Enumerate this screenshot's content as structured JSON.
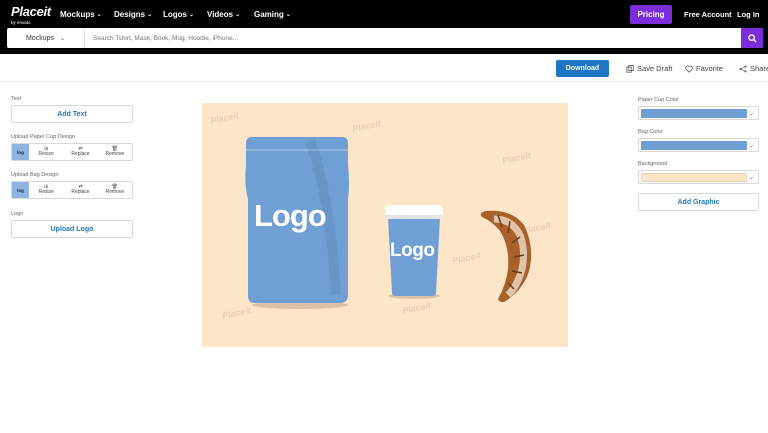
{
  "brand": {
    "name": "Placeit",
    "tagline": "by envato"
  },
  "nav": {
    "items": [
      {
        "label": "Mockups"
      },
      {
        "label": "Designs"
      },
      {
        "label": "Logos"
      },
      {
        "label": "Videos"
      },
      {
        "label": "Gaming"
      }
    ],
    "pricing": "Pricing",
    "free_account": "Free Account",
    "login": "Log In"
  },
  "search": {
    "category": "Mockups",
    "placeholder": "Search Tshirt, Mask, Book, Mug, Hoodie, iPhone..."
  },
  "toolbar": {
    "download": "Download",
    "save_draft": "Save Draft",
    "favorite": "Favorite",
    "share": "Share"
  },
  "left_panel": {
    "text_label": "Text",
    "add_text": "Add Text",
    "cup_design_label": "Upload Paper Cup Design",
    "bag_design_label": "Upload Bag Design",
    "thumb_text": "log",
    "actions": [
      "Resize",
      "Replace",
      "Remove"
    ],
    "logo_label": "Logo",
    "upload_logo": "Upload Logo"
  },
  "canvas": {
    "bag_logo": "Logo",
    "cup_logo": "Logo",
    "watermark": "Placeit"
  },
  "right_panel": {
    "cup_color_label": "Paper Cup Color",
    "bag_color_label": "Bag Color",
    "background_label": "Background",
    "add_graphic": "Add Graphic"
  },
  "colors": {
    "accent_purple": "#7b2ddc",
    "download_blue": "#1f76c6",
    "cup_color": "#6f9fd4",
    "bag_color": "#6f9fd4",
    "background_color": "#fde5c8"
  }
}
